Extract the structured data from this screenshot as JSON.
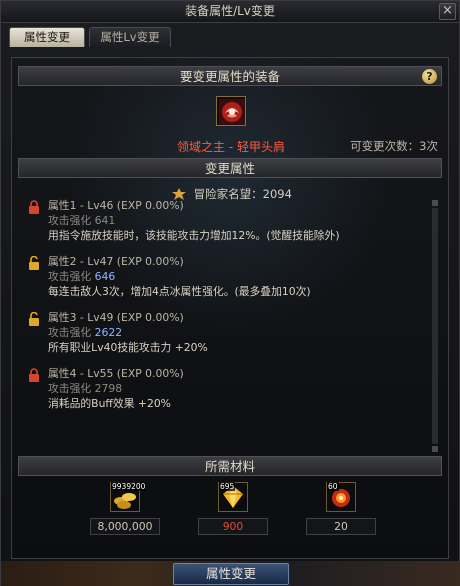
{
  "window": {
    "title": "装备属性/Lv变更",
    "close_glyph": "×"
  },
  "tabs": [
    {
      "label": "属性变更",
      "active": true
    },
    {
      "label": "属性Lv变更",
      "active": false
    }
  ],
  "equipment_section": {
    "header": "要变更属性的装备",
    "help_glyph": "?",
    "item_name": "领域之主 - 轻甲头肩",
    "change_count": "可变更次数：3次"
  },
  "change_section": {
    "header": "变更属性",
    "adventurer_fame": "冒险家名望：2094",
    "attributes": [
      {
        "title": "属性1 - Lv46 (EXP 0.00%)",
        "stat_label": "攻击强化 ",
        "stat_value": "641",
        "stat_color": "normal",
        "effect": "用指令施放技能时，该技能攻击力增加12%。(觉醒技能除外)",
        "lock": "locked",
        "lock_color": "#d8452f"
      },
      {
        "title": "属性2 - Lv47 (EXP 0.00%)",
        "stat_label": "攻击强化 ",
        "stat_value": "646",
        "stat_color": "blue",
        "effect": "每连击敌人3次，增加4点冰属性强化。(最多叠加10次)",
        "lock": "unlocked",
        "lock_color": "#e0a62a"
      },
      {
        "title": "属性3 - Lv49 (EXP 0.00%)",
        "stat_label": "攻击强化 ",
        "stat_value": "2622",
        "stat_color": "blue",
        "effect": "所有职业Lv40技能攻击力 +20%",
        "lock": "unlocked",
        "lock_color": "#e0a62a"
      },
      {
        "title": "属性4 - Lv55 (EXP 0.00%)",
        "stat_label": "攻击强化 ",
        "stat_value": "2798",
        "stat_color": "normal",
        "effect": "消耗品的Buff效果 +20%",
        "lock": "locked",
        "lock_color": "#d8452f"
      }
    ]
  },
  "materials_section": {
    "header": "所需材料",
    "items": [
      {
        "icon": "gold-coins-icon",
        "badge": "9939200",
        "quantity": "8,000,000",
        "quantity_color": "normal"
      },
      {
        "icon": "gem-crystal-icon",
        "badge": "695",
        "quantity": "900",
        "quantity_color": "red"
      },
      {
        "icon": "fire-orb-icon",
        "badge": "60",
        "quantity": "20",
        "quantity_color": "normal"
      }
    ]
  },
  "action": {
    "button_label": "属性变更"
  },
  "colors": {
    "accent_red": "#ff5a3d",
    "stat_blue": "#8fb7ff",
    "button_blue": "#3a5376"
  }
}
